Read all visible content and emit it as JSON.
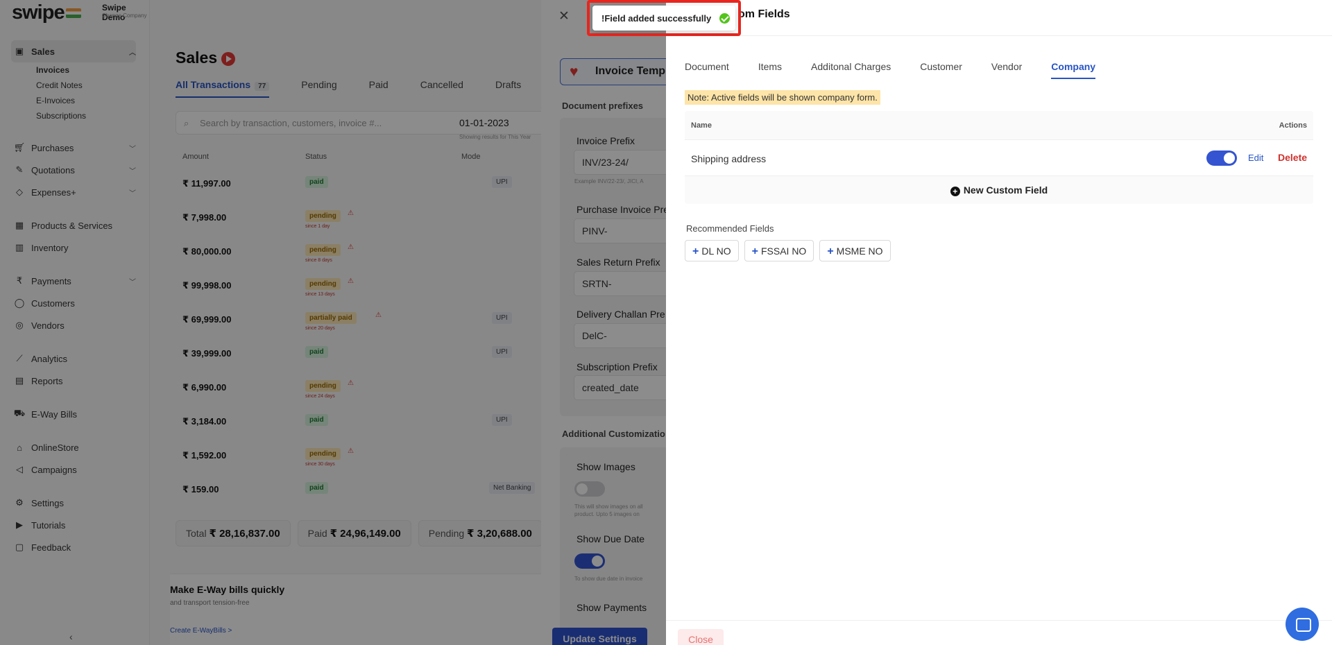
{
  "sidebar": {
    "logo": "swipe",
    "company_name": "Swipe Demo",
    "company_sub": "Change Company",
    "sales_label": "Sales",
    "sales_sub": [
      "Invoices",
      "Credit Notes",
      "E-Invoices",
      "Subscriptions"
    ],
    "items_a": [
      {
        "label": "Purchases",
        "icon": "cart-icon"
      },
      {
        "label": "Quotations",
        "icon": "pen-icon"
      },
      {
        "label": "Expenses+",
        "icon": "tag-icon"
      }
    ],
    "items_b": [
      {
        "label": "Products & Services",
        "icon": "box-icon"
      },
      {
        "label": "Inventory",
        "icon": "warehouse-icon"
      }
    ],
    "items_c": [
      {
        "label": "Payments",
        "icon": "rupee-icon"
      },
      {
        "label": "Customers",
        "icon": "user-icon"
      },
      {
        "label": "Vendors",
        "icon": "users-icon"
      }
    ],
    "items_d": [
      {
        "label": "Analytics",
        "icon": "chart-icon"
      },
      {
        "label": "Reports",
        "icon": "document-icon"
      }
    ],
    "items_e": [
      {
        "label": "E-Way Bills",
        "icon": "truck-icon"
      }
    ],
    "items_f": [
      {
        "label": "OnlineStore",
        "icon": "store-icon"
      },
      {
        "label": "Campaigns",
        "icon": "megaphone-icon"
      }
    ],
    "items_g": [
      {
        "label": "Settings",
        "icon": "gear-icon"
      },
      {
        "label": "Tutorials",
        "icon": "youtube-icon"
      },
      {
        "label": "Feedback",
        "icon": "chat-icon"
      }
    ]
  },
  "sales_page": {
    "title": "Sales",
    "tabs": [
      "All Transactions",
      "Pending",
      "Paid",
      "Cancelled",
      "Drafts"
    ],
    "all_count": "77",
    "search_placeholder": "Search by transaction, customers, invoice #...",
    "date": "01-01-2023",
    "date_sub": "Showing results for This Year",
    "headers": [
      "Amount",
      "Status",
      "Mode"
    ],
    "rows": [
      {
        "amount": "₹ 11,997.00",
        "status": "paid",
        "due": "",
        "mode": "UPI"
      },
      {
        "amount": "₹ 7,998.00",
        "status": "pending",
        "due": "since 1 day",
        "mode": ""
      },
      {
        "amount": "₹ 80,000.00",
        "status": "pending",
        "due": "since 8 days",
        "mode": ""
      },
      {
        "amount": "₹ 99,998.00",
        "status": "pending",
        "due": "since 13 days",
        "mode": ""
      },
      {
        "amount": "₹ 69,999.00",
        "status": "partially paid",
        "due": "since 20 days",
        "mode": "UPI"
      },
      {
        "amount": "₹ 39,999.00",
        "status": "paid",
        "due": "",
        "mode": "UPI"
      },
      {
        "amount": "₹ 6,990.00",
        "status": "pending",
        "due": "since 24 days",
        "mode": ""
      },
      {
        "amount": "₹ 3,184.00",
        "status": "paid",
        "due": "",
        "mode": "UPI"
      },
      {
        "amount": "₹ 1,592.00",
        "status": "pending",
        "due": "since 30 days",
        "mode": ""
      },
      {
        "amount": "₹ 159.00",
        "status": "paid",
        "due": "",
        "mode": "Net Banking"
      }
    ],
    "totals": [
      {
        "label": "Total",
        "value": "₹ 28,16,837.00"
      },
      {
        "label": "Paid",
        "value": "₹ 24,96,149.00"
      },
      {
        "label": "Pending",
        "value": "₹ 3,20,688.00"
      }
    ],
    "eway": {
      "title": "Make E-Way bills quickly",
      "sub": "and transport tension-free",
      "link": "Create E-WayBills >"
    }
  },
  "settings_drawer": {
    "template_btn": "Invoice Temp",
    "doc_prefixes_label": "Document prefixes",
    "prefixes": [
      {
        "label": "Invoice Prefix",
        "value": "INV/23-24/",
        "hint": "Example INV/22-23/, JICI, A"
      },
      {
        "label": "Purchase Invoice Pre",
        "value": "PINV-",
        "hint": ""
      },
      {
        "label": "Sales Return Prefix",
        "value": "SRTN-",
        "hint": ""
      },
      {
        "label": "Delivery Challan Pre",
        "value": "DelC-",
        "hint": ""
      },
      {
        "label": "Subscription Prefix",
        "value": "created_date",
        "hint": ""
      }
    ],
    "additional_label": "Additional Customizatio",
    "show_images": {
      "label": "Show Images",
      "on": false,
      "hint1": "This will show images on all",
      "hint2": "product. Upto 5 images on"
    },
    "show_due_date": {
      "label": "Show Due Date",
      "on": true,
      "hint1": "To show due date in invoice"
    },
    "show_payments": {
      "label": "Show Payments"
    },
    "update_btn": "Update Settings"
  },
  "custom_fields": {
    "title": "om Fields",
    "tabs": [
      "Document",
      "Items",
      "Additonal Charges",
      "Customer",
      "Vendor",
      "Company"
    ],
    "active_tab": "Company",
    "note": "Note: Active fields will be shown company form.",
    "table_headers": {
      "name": "Name",
      "actions": "Actions"
    },
    "field": {
      "name": "Shipping address",
      "active": true,
      "edit": "Edit",
      "delete": "Delete"
    },
    "new_field": "New Custom Field",
    "recommended_label": "Recommended Fields",
    "recommended": [
      "DL NO",
      "FSSAI NO",
      "MSME NO"
    ],
    "close_btn": "Close"
  },
  "toast": {
    "message": "!Field added successfully"
  },
  "colors": {
    "accent": "#2754c5",
    "danger": "#d0312d",
    "toast_border": "#e8261f",
    "success": "#52c41a"
  }
}
